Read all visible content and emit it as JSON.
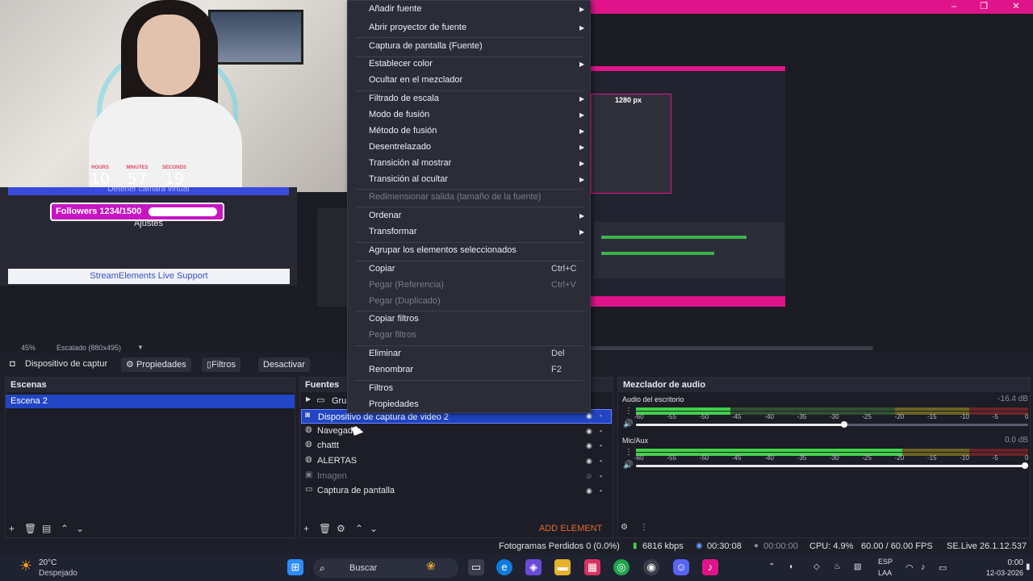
{
  "window": {
    "controls": [
      "–",
      "❐",
      "✕"
    ]
  },
  "overlay": {
    "timer": {
      "labels": [
        "HOURS",
        "MINUTES",
        "SECONDS"
      ],
      "values": [
        "10",
        "57",
        "19"
      ]
    },
    "virtualcam_label": "Detener cámara virtual",
    "followers_label": "Followers 1234/1500",
    "followers_progress": 0.82,
    "ajustes_label": "Ajustes",
    "streamelements_label": "StreamElements Live Support"
  },
  "preview": {
    "inner_label": "1280 px",
    "zoom": "45%",
    "scale": "Escalado (880x495)"
  },
  "source_toolbar": {
    "source_name": "Dispositivo de captur",
    "properties": "Propiedades",
    "filters": "Filtros",
    "deactivate": "Desactivar"
  },
  "context_menu": {
    "items": [
      {
        "label": "Añadir fuente",
        "arrow": true
      },
      {
        "label": "Abrir proyector de fuente",
        "arrow": true
      },
      {
        "label": "Captura de pantalla (Fuente)"
      },
      {
        "label": "Establecer color",
        "arrow": true
      },
      {
        "label": "Ocultar en el mezclador"
      },
      {
        "label": "Filtrado de escala",
        "arrow": true
      },
      {
        "label": "Modo de fusión",
        "arrow": true
      },
      {
        "label": "Método de fusión",
        "arrow": true
      },
      {
        "label": "Desentrelazado",
        "arrow": true
      },
      {
        "label": "Transición al mostrar",
        "arrow": true
      },
      {
        "label": "Transición al ocultar",
        "arrow": true
      },
      {
        "label": "Redimensionar salida (tamaño de la fuente)",
        "disabled": true
      },
      {
        "label": "Ordenar",
        "arrow": true
      },
      {
        "label": "Transformar",
        "arrow": true
      },
      {
        "label": "Agrupar los elementos seleccionados"
      },
      {
        "label": "Copiar",
        "shortcut": "Ctrl+C"
      },
      {
        "label": "Pegar (Referencia)",
        "shortcut": "Ctrl+V",
        "disabled": true
      },
      {
        "label": "Pegar (Duplicado)",
        "disabled": true
      },
      {
        "label": "Copiar filtros"
      },
      {
        "label": "Pegar filtros",
        "disabled": true
      },
      {
        "label": "Eliminar",
        "shortcut": "Del"
      },
      {
        "label": "Renombrar",
        "shortcut": "F2"
      },
      {
        "label": "Filtros"
      },
      {
        "label": "Propiedades"
      }
    ]
  },
  "scenes": {
    "title": "Escenas",
    "items": [
      "Escena 2"
    ]
  },
  "sources": {
    "title": "Fuentes",
    "items": [
      {
        "name": "Grup",
        "icon": "folder-icon"
      },
      {
        "name": "Dispositivo de captura de video 2",
        "icon": "camera-icon",
        "selected": true
      },
      {
        "name": "Navegador",
        "icon": "globe-icon"
      },
      {
        "name": "chattt",
        "icon": "globe-icon"
      },
      {
        "name": "ALERTAS",
        "icon": "globe-icon"
      },
      {
        "name": "Imagen",
        "icon": "image-icon",
        "hidden": true
      },
      {
        "name": "Captura de pantalla",
        "icon": "monitor-icon"
      }
    ],
    "add_element": "ADD ELEMENT"
  },
  "mixer": {
    "title": "Mezclador de audio",
    "channels": [
      {
        "name": "Audio del escritorio",
        "db": "-16.4 dB",
        "level": 0.24,
        "volume": 0.53
      },
      {
        "name": "Mic/Aux",
        "db": "0.0 dB",
        "level": 0.68,
        "volume": 1.0
      }
    ],
    "scale": [
      "-60",
      "-55",
      "-50",
      "-45",
      "-40",
      "-35",
      "-30",
      "-25",
      "-20",
      "-15",
      "-10",
      "-5",
      "0"
    ]
  },
  "status": {
    "dropped": "Fotogramas Perdidos 0 (0.0%)",
    "bitrate": "6816 kbps",
    "live_time": "00:30:08",
    "rec_time": "00:00:00",
    "cpu": "CPU: 4.9%",
    "fps": "60.00 / 60.00 FPS",
    "version": "SE.Live 26.1.12.537"
  },
  "taskbar": {
    "weather_temp": "20°C",
    "weather_desc": "Despejado",
    "search": "Buscar",
    "lang_top": "ESP",
    "lang_bottom": "LAA",
    "time": "0:00",
    "date": "12-03-2026"
  }
}
